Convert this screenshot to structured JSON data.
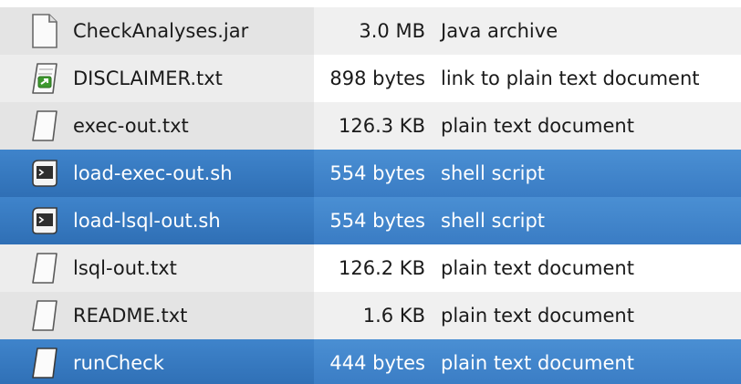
{
  "files": [
    {
      "name": "CheckAnalyses.jar",
      "size": "3.0 MB",
      "type": "Java archive",
      "icon": "document-blank-icon",
      "selected": false
    },
    {
      "name": "DISCLAIMER.txt",
      "size": "898 bytes",
      "type": "link to plain text document",
      "icon": "text-link-icon",
      "selected": false
    },
    {
      "name": "exec-out.txt",
      "size": "126.3 KB",
      "type": "plain text document",
      "icon": "text-document-icon",
      "selected": false
    },
    {
      "name": "load-exec-out.sh",
      "size": "554 bytes",
      "type": "shell script",
      "icon": "shell-script-icon",
      "selected": true
    },
    {
      "name": "load-lsql-out.sh",
      "size": "554 bytes",
      "type": "shell script",
      "icon": "shell-script-icon",
      "selected": true
    },
    {
      "name": "lsql-out.txt",
      "size": "126.2 KB",
      "type": "plain text document",
      "icon": "text-document-icon",
      "selected": false
    },
    {
      "name": "README.txt",
      "size": "1.6 KB",
      "type": "plain text document",
      "icon": "text-document-icon",
      "selected": false
    },
    {
      "name": "runCheck",
      "size": "444 bytes",
      "type": "plain text document",
      "icon": "text-document-icon",
      "selected": true
    }
  ],
  "colors": {
    "selection": "#3a7cc4",
    "row_alt": "#f0f0f0",
    "name_column": "#e4e4e4"
  }
}
